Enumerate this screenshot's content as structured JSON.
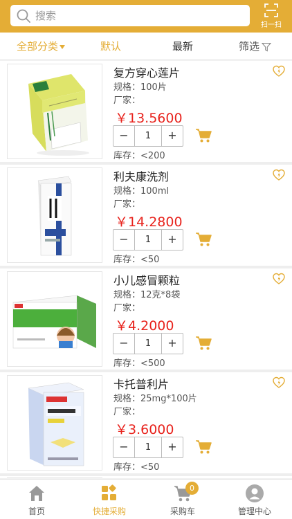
{
  "search": {
    "placeholder": "搜索",
    "scan_label": "扫一扫"
  },
  "filters": {
    "all": "全部分类",
    "default": "默认",
    "latest": "最新",
    "filter": "筛选"
  },
  "products": [
    {
      "name": "复方穿心莲片",
      "spec": "规格：100片",
      "maker": "厂家：",
      "price": "￥13.5600",
      "qty": "1",
      "stock": "库存：<200"
    },
    {
      "name": "利夫康洗剂",
      "spec": "规格：100ml",
      "maker": "厂家：",
      "price": "￥14.2800",
      "qty": "1",
      "stock": "库存：<50"
    },
    {
      "name": "小儿感冒颗粒",
      "spec": "规格：12克*8袋",
      "maker": "厂家：",
      "price": "￥4.2000",
      "qty": "1",
      "stock": "库存：<500"
    },
    {
      "name": "卡托普利片",
      "spec": "规格：25mg*100片",
      "maker": "厂家：",
      "price": "￥3.6000",
      "qty": "1",
      "stock": "库存：<50"
    }
  ],
  "stepper": {
    "minus": "−",
    "plus": "+"
  },
  "tabs": [
    {
      "label": "首页",
      "icon": "home-icon"
    },
    {
      "label": "快捷采购",
      "icon": "quick-purchase-icon"
    },
    {
      "label": "采购车",
      "icon": "cart-icon",
      "badge": "0"
    },
    {
      "label": "管理中心",
      "icon": "user-icon"
    }
  ],
  "colors": {
    "accent": "#e4ad36",
    "price": "#e8231d"
  }
}
